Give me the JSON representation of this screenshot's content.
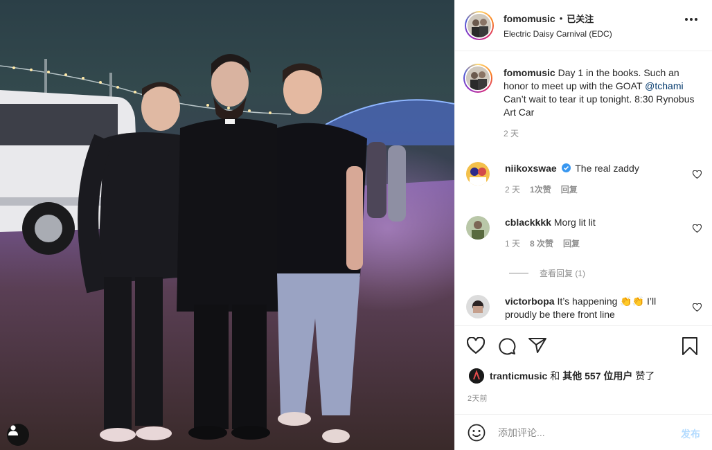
{
  "post": {
    "username": "fomomusic",
    "separator": "•",
    "follow_status": "已关注",
    "location": "Electric Daisy Carnival (EDC)"
  },
  "caption": {
    "username": "fomomusic",
    "text_before": "Day 1 in the books. Such an honor to meet up with the GOAT",
    "mention": "@tchami",
    "text_after": "Can’t wait to tear it up tonight. 8:30 Rynobus Art Car",
    "time": "2 天"
  },
  "comments": [
    {
      "username": "niikoxswae",
      "verified": true,
      "text": "The real zaddy",
      "time": "2 天",
      "likes": "1次赞",
      "reply": "回复"
    },
    {
      "username": "cblackkkk",
      "verified": false,
      "text": "Morg lit lit",
      "time": "1 天",
      "likes": "8 次赞",
      "reply": "回复"
    },
    {
      "username": "victorbopa",
      "verified": false,
      "text": "It’s happening 👏👏 I’ll proudly be there front line"
    }
  ],
  "view_replies": "查看回复 (1)",
  "likes": {
    "user": "tranticmusic",
    "joiner": "和",
    "others": "其他 557 位用户",
    "suffix": "赞了"
  },
  "post_time": "2天前",
  "composer": {
    "placeholder": "添加评论...",
    "post_label": "发布"
  },
  "colors": {
    "link": "#00376b",
    "verified": "#3897f0",
    "post_disabled": "#b3dbff"
  },
  "icons": [
    "more-icon",
    "heart-icon",
    "comment-icon",
    "share-icon",
    "bookmark-icon",
    "emoji-icon",
    "verified-icon",
    "user-tag-icon"
  ]
}
